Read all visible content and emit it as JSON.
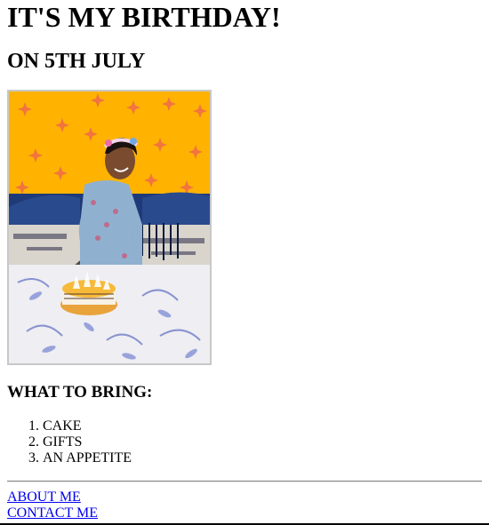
{
  "header": {
    "title": "IT'S MY BIRTHDAY!",
    "subtitle": "ON 5TH JULY"
  },
  "photo": {
    "icon": "birthday-photo"
  },
  "bring": {
    "heading": "WHAT TO BRING:",
    "items": [
      "CAKE",
      "GIFTS",
      "AN APPETITE"
    ]
  },
  "nav": {
    "about": "ABOUT ME",
    "contact": "CONTACT ME"
  },
  "colors": {
    "link": "#0000ee",
    "wall": "#ffb800",
    "border": "#c8c8c8"
  }
}
